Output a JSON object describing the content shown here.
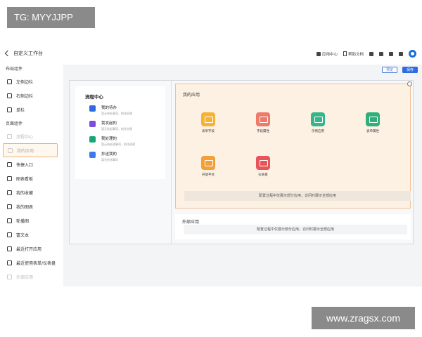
{
  "watermarks": {
    "top": "TG: MYYJJPP",
    "bottom": "www.zragsx.com"
  },
  "header": {
    "back_label": "自定义工作台",
    "app_center": "应用中心",
    "help_docs": "帮助文档"
  },
  "sidebar": {
    "layout_title": "布局组件",
    "layout_items": [
      "左侧边栏",
      "右侧边栏",
      "单栏"
    ],
    "page_title": "页面组件",
    "page_items": [
      {
        "label": "流程中心",
        "state": "disabled"
      },
      {
        "label": "我的应用",
        "state": "selected"
      },
      {
        "label": "快捷入口",
        "state": "normal"
      },
      {
        "label": "图表看板",
        "state": "normal"
      },
      {
        "label": "我的收藏",
        "state": "normal"
      },
      {
        "label": "我的图表",
        "state": "normal"
      },
      {
        "label": "轮播图",
        "state": "normal"
      },
      {
        "label": "富文本",
        "state": "normal"
      },
      {
        "label": "最近打开应用",
        "state": "normal"
      },
      {
        "label": "最近使用表单/仪表盘",
        "state": "normal"
      },
      {
        "label": "外部应用",
        "state": "disabled"
      }
    ]
  },
  "toolbar": {
    "preview_label": "预览",
    "save_label": "保存"
  },
  "flow_center": {
    "title": "流程中心",
    "items": [
      {
        "title": "我的待办",
        "sub": "暂无待办事项，前往创建",
        "color": "#2f6be0"
      },
      {
        "title": "我发起的",
        "sub": "暂无发起事项，前往创建",
        "color": "#7b4fd6"
      },
      {
        "title": "我处理的",
        "sub": "暂无待处理事项，前往创建",
        "color": "#19a57a"
      },
      {
        "title": "抄送我的",
        "sub": "暂无抄送事项",
        "color": "#3b7be8"
      }
    ]
  },
  "my_apps": {
    "title": "我的应用",
    "apps": [
      {
        "label": "表单字段",
        "color": "#f5b335"
      },
      {
        "label": "字段属性",
        "color": "#f07a6a"
      },
      {
        "label": "示例应用",
        "color": "#35b58a"
      },
      {
        "label": "表单属性",
        "color": "#2fb07a"
      },
      {
        "label": "开放平台",
        "color": "#f2a037"
      },
      {
        "label": "仪表盘",
        "color": "#e8545a"
      }
    ],
    "hint": "配置过程中仅展示部分应用，访问时展示全部应用"
  },
  "external_apps": {
    "title": "外部应用",
    "hint": "配置过程中仅展示部分应用，访问时展示全部应用"
  }
}
